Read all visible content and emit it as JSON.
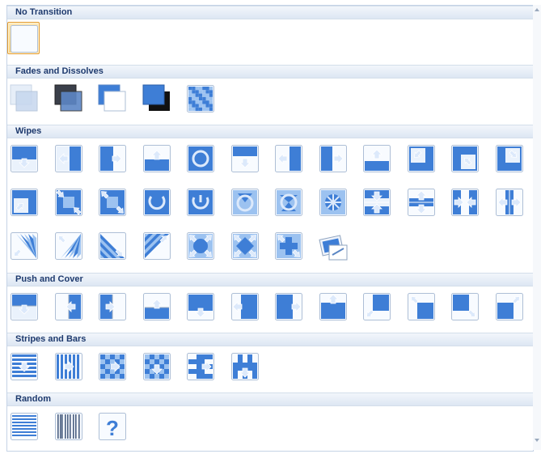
{
  "sections": [
    {
      "id": "no-transition",
      "title": "No Transition",
      "rows": [
        [
          "none"
        ]
      ]
    },
    {
      "id": "fades",
      "title": "Fades and Dissolves",
      "rows": [
        [
          "fade-smoothly",
          "fade-black",
          "cut",
          "cut-black",
          "dissolve"
        ]
      ]
    },
    {
      "id": "wipes",
      "title": "Wipes",
      "rows": [
        [
          "wipe-down",
          "wipe-left",
          "wipe-right",
          "wipe-up",
          "wheel-clockwise",
          "uncover-down",
          "uncover-left",
          "uncover-right",
          "uncover-up",
          "uncover-left-down",
          "uncover-left-up",
          "uncover-right-down"
        ],
        [
          "uncover-right-up",
          "box-in",
          "box-out",
          "wheel-1-spoke",
          "wheel-2-spokes",
          "wheel-3-spokes",
          "wheel-4-spokes",
          "wheel-8-spokes",
          "split-h-in",
          "split-h-out",
          "split-v-in",
          "split-v-out"
        ],
        [
          "strips-left-down",
          "strips-left-up",
          "strips-right-down",
          "strips-right-up",
          "circle",
          "diamond",
          "plus",
          "newsflash"
        ]
      ]
    },
    {
      "id": "push-cover",
      "title": "Push and Cover",
      "rows": [
        [
          "push-down",
          "push-left",
          "push-right",
          "push-up",
          "cover-down",
          "cover-left",
          "cover-right",
          "cover-up",
          "cover-left-down",
          "cover-left-up",
          "cover-right-down",
          "cover-right-up"
        ]
      ]
    },
    {
      "id": "stripes-bars",
      "title": "Stripes and Bars",
      "rows": [
        [
          "blinds-horizontal",
          "blinds-vertical",
          "checkerboard-across",
          "checkerboard-down",
          "comb-horizontal",
          "comb-vertical"
        ]
      ]
    },
    {
      "id": "random",
      "title": "Random",
      "rows": [
        [
          "random-bars-horizontal",
          "random-bars-vertical",
          "random-transition"
        ]
      ]
    }
  ],
  "selected": "none",
  "colors": {
    "blue": "#3e7ed6",
    "blueLight": "#9cc2f0",
    "frame": "#aebfd6",
    "header": "#1e3a6e",
    "selectBorder": "#e29a2f"
  }
}
